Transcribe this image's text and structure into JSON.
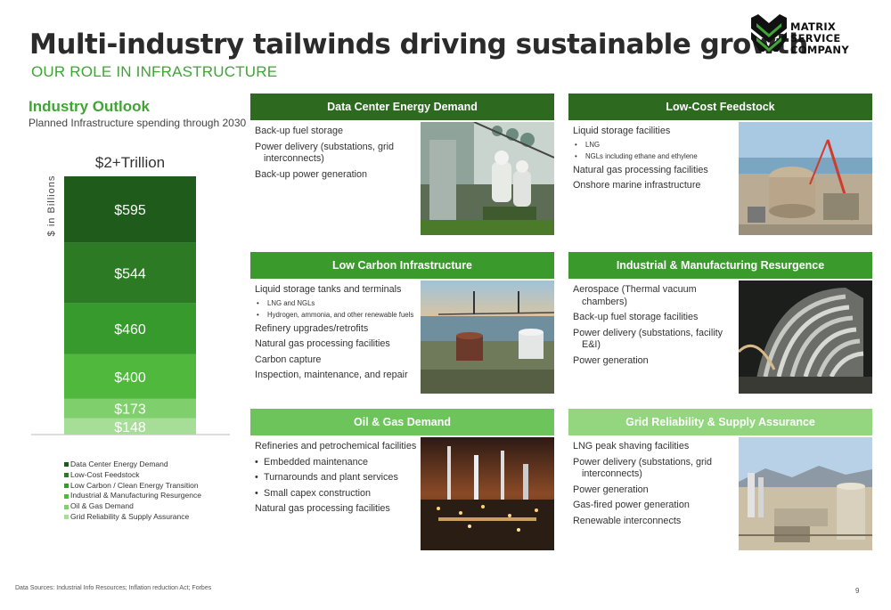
{
  "title": "Multi-industry tailwinds driving sustainable growth",
  "subtitle": "OUR ROLE IN INFRASTRUCTURE",
  "logo": {
    "line1": "MATRIX SERVICE",
    "line2": "COMPANY"
  },
  "outlook": {
    "title": "Industry Outlook",
    "subtitle": "Planned Infrastructure spending through 2030"
  },
  "chart_data": {
    "type": "bar",
    "stacked": true,
    "title": "$2+Trillion",
    "xlabel": "",
    "ylabel": "$ in Billions",
    "categories": [
      ""
    ],
    "series": [
      {
        "name": "Data Center Energy Demand",
        "values": [
          595
        ],
        "label": "$595",
        "color": "#1f5c1c"
      },
      {
        "name": "Low-Cost Feedstock",
        "values": [
          544
        ],
        "label": "$544",
        "color": "#2c7a24"
      },
      {
        "name": "Low Carbon / Clean Energy Transition",
        "values": [
          460
        ],
        "label": "$460",
        "color": "#379a2c"
      },
      {
        "name": "Industrial & Manufacturing Resurgence",
        "values": [
          400
        ],
        "label": "$400",
        "color": "#4fb83d"
      },
      {
        "name": "Oil & Gas Demand",
        "values": [
          173
        ],
        "label": "$173",
        "color": "#7fd06d"
      },
      {
        "name": "Grid Reliability & Supply Assurance",
        "values": [
          148
        ],
        "label": "$148",
        "color": "#a6dd97"
      }
    ],
    "legend_position": "bottom-left",
    "grid": false
  },
  "cards": [
    {
      "title": "Data Center Energy Demand",
      "color": "#2d6a1f",
      "image_icon": "utility-workers-photo",
      "items": [
        {
          "type": "main",
          "text": "Back-up fuel storage"
        },
        {
          "type": "main",
          "text": "Power delivery (substations, grid interconnects)"
        },
        {
          "type": "main",
          "text": "Back-up power generation"
        }
      ]
    },
    {
      "title": "Low-Cost Feedstock",
      "color": "#2d6a1f",
      "image_icon": "storage-tank-construction-photo",
      "items": [
        {
          "type": "main",
          "text": "Liquid storage facilities"
        },
        {
          "type": "sub",
          "text": "LNG"
        },
        {
          "type": "sub",
          "text": "NGLs including ethane and ethylene"
        },
        {
          "type": "main",
          "text": "Natural gas processing facilities"
        },
        {
          "type": "main",
          "text": "Onshore marine infrastructure"
        }
      ]
    },
    {
      "title": "Low Carbon Infrastructure",
      "color": "#3a9a2c",
      "image_icon": "coastal-terminal-photo",
      "items": [
        {
          "type": "main",
          "text": "Liquid storage tanks and terminals"
        },
        {
          "type": "sub",
          "text": "LNG and NGLs"
        },
        {
          "type": "sub",
          "text": "Hydrogen, ammonia, and other renewable fuels"
        },
        {
          "type": "main",
          "text": "Refinery upgrades/retrofits"
        },
        {
          "type": "main",
          "text": "Natural gas processing facilities"
        },
        {
          "type": "main",
          "text": "Carbon capture"
        },
        {
          "type": "main",
          "text": "Inspection, maintenance, and repair"
        }
      ]
    },
    {
      "title": "Industrial & Manufacturing Resurgence",
      "color": "#3a9a2c",
      "image_icon": "thermal-vacuum-chamber-photo",
      "items": [
        {
          "type": "main",
          "text": "Aerospace (Thermal vacuum chambers)"
        },
        {
          "type": "main",
          "text": "Back-up fuel storage facilities"
        },
        {
          "type": "main",
          "text": "Power delivery (substations, facility E&I)"
        },
        {
          "type": "main",
          "text": "Power generation"
        }
      ]
    },
    {
      "title": "Oil & Gas Demand",
      "color": "#6cc45a",
      "image_icon": "refinery-at-night-photo",
      "items": [
        {
          "type": "main",
          "text": "Refineries and petrochemical facilities"
        },
        {
          "type": "bullet",
          "text": "Embedded maintenance"
        },
        {
          "type": "bullet",
          "text": "Turnarounds and plant services"
        },
        {
          "type": "bullet",
          "text": "Small capex construction"
        },
        {
          "type": "main",
          "text": "Natural gas processing facilities"
        }
      ]
    },
    {
      "title": "Grid Reliability & Supply Assurance",
      "color": "#93d67f",
      "image_icon": "lng-peak-shaving-plant-photo",
      "items": [
        {
          "type": "main",
          "text": "LNG peak shaving facilities"
        },
        {
          "type": "main",
          "text": "Power delivery (substations, grid interconnects)"
        },
        {
          "type": "main",
          "text": "Power generation"
        },
        {
          "type": "main",
          "text": "Gas-fired power generation"
        },
        {
          "type": "main",
          "text": "Renewable interconnects"
        }
      ]
    }
  ],
  "footnote": "Data Sources: Industrial Info Resources; Inflation reduction Act; Forbes",
  "page_number": "9"
}
